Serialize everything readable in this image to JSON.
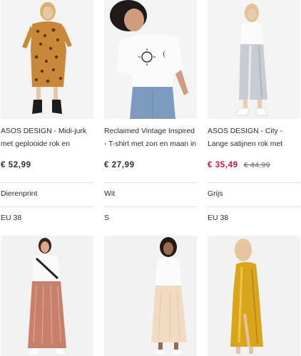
{
  "products": [
    {
      "title": "ASOS DESIGN - Midi-jurk met geplooide rok en",
      "price": "€ 52,99",
      "old_price": "",
      "color": "Dierenprint",
      "size": "EU 38",
      "image_icon": "leopard-dress-photo"
    },
    {
      "title": "Reclaimed Vintage Inspired - T-shirt met zon en maan in",
      "price": "€ 27,99",
      "old_price": "",
      "color": "Wit",
      "size": "S",
      "image_icon": "tshirt-photo"
    },
    {
      "title": "ASOS DESIGN - City - Lange satijnen rok met",
      "price": "€ 35,49",
      "old_price": "€ 44,99",
      "color": "Grijs",
      "size": "EU 38",
      "image_icon": "satin-skirt-photo"
    }
  ],
  "next_row_images": [
    "pink-satin-skirt-photo",
    "cream-satin-skirt-photo",
    "mustard-satin-dress-photo"
  ],
  "colors": {
    "sale": "#d01345",
    "text": "#2d2d2d",
    "divider": "#dddddd"
  }
}
